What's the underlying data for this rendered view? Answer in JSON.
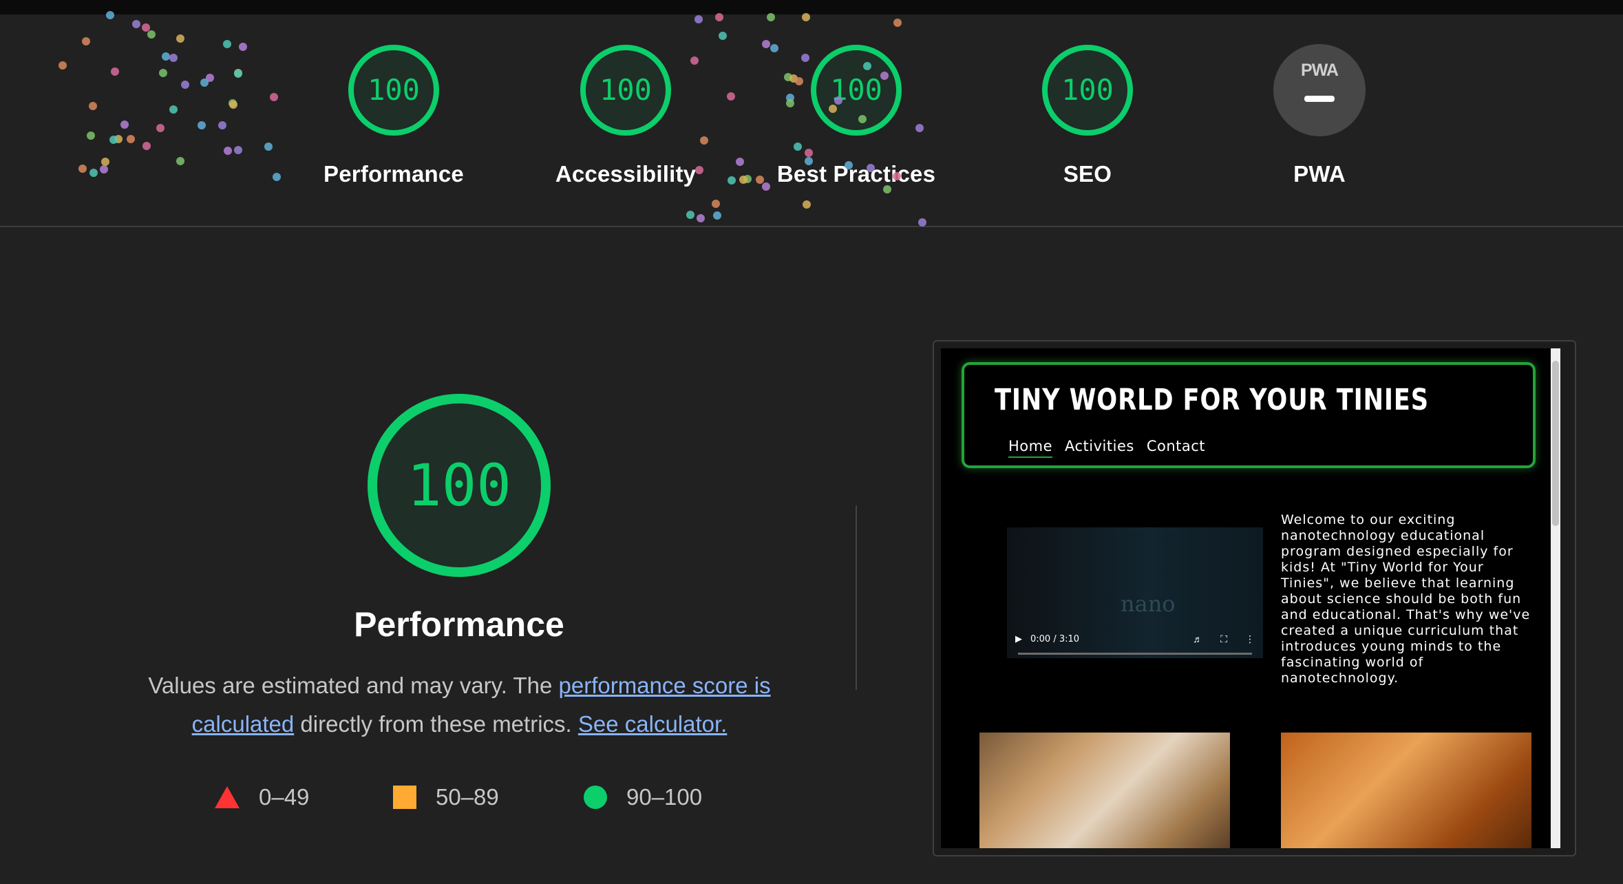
{
  "colors": {
    "pass": "#0cce6b",
    "average": "#ffaa33",
    "fail": "#ff3333",
    "link": "#8ab4f8",
    "background": "#212121"
  },
  "categories": [
    {
      "id": "performance",
      "score": "100",
      "label": "Performance"
    },
    {
      "id": "accessibility",
      "score": "100",
      "label": "Accessibility"
    },
    {
      "id": "best-practices",
      "score": "100",
      "label": "Best Practices"
    },
    {
      "id": "seo",
      "score": "100",
      "label": "SEO"
    },
    {
      "id": "pwa",
      "badge_text": "PWA",
      "label": "PWA"
    }
  ],
  "performance": {
    "score": "100",
    "title": "Performance",
    "desc_pre": "Values are estimated and may vary. The ",
    "desc_link1": "performance score is calculated",
    "desc_mid": " directly from these metrics. ",
    "desc_link2": "See calculator."
  },
  "legend": [
    {
      "shape": "triangle",
      "range": "0–49"
    },
    {
      "shape": "square",
      "range": "50–89"
    },
    {
      "shape": "circle",
      "range": "90–100"
    }
  ],
  "screenshot": {
    "site_title": "TINY WORLD FOR YOUR TINIES",
    "nav": [
      "Home",
      "Activities",
      "Contact"
    ],
    "video_watermark": "nano",
    "video_time": "0:00 / 3:10",
    "intro_text": "Welcome to our exciting nanotechnology educational program designed especially for kids! At \"Tiny World for Your Tinies\", we believe that learning about science should be both fun and educational. That's why we've created a unique curriculum that introduces young minds to the fascinating world of nanotechnology."
  }
}
